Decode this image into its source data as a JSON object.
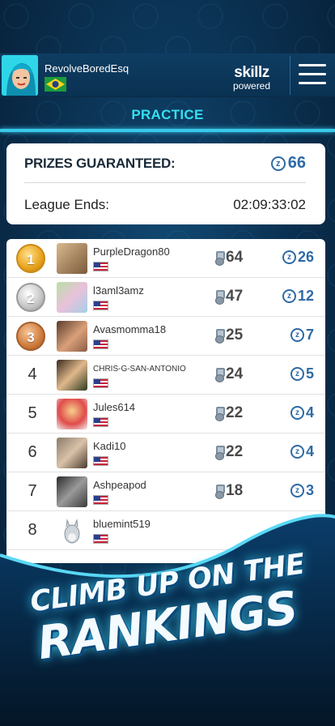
{
  "header": {
    "username": "RevolveBoredEsq",
    "brand_line1": "skillz",
    "brand_line2": "powered",
    "mode_label": "PRACTICE"
  },
  "prize_card": {
    "label": "PRIZES GUARANTEED:",
    "value": "66",
    "league_label": "League Ends:",
    "league_time": "02:09:33:02"
  },
  "rankings": [
    {
      "rank": "1",
      "medal": "gold",
      "name": "PurpleDragon80",
      "trophies": "64",
      "prize": "26"
    },
    {
      "rank": "2",
      "medal": "silver",
      "name": "l3aml3amz",
      "trophies": "47",
      "prize": "12"
    },
    {
      "rank": "3",
      "medal": "bronze",
      "name": "Avasmomma18",
      "trophies": "25",
      "prize": "7"
    },
    {
      "rank": "4",
      "medal": "",
      "name": "CHRIS-G-SAN-ANTONIO",
      "trophies": "24",
      "prize": "5"
    },
    {
      "rank": "5",
      "medal": "",
      "name": "Jules614",
      "trophies": "22",
      "prize": "4"
    },
    {
      "rank": "6",
      "medal": "",
      "name": "Kadi10",
      "trophies": "22",
      "prize": "4"
    },
    {
      "rank": "7",
      "medal": "",
      "name": "Ashpeapod",
      "trophies": "18",
      "prize": "3"
    },
    {
      "rank": "8",
      "medal": "",
      "name": "bluemint519",
      "trophies": "",
      "prize": ""
    }
  ],
  "promo": {
    "line1": "CLIMB UP ON THE",
    "line2": "RANKINGS"
  },
  "colors": {
    "accent_cyan": "#35e0f0",
    "coin_blue": "#2e6aa6",
    "background": "#0b3456"
  }
}
